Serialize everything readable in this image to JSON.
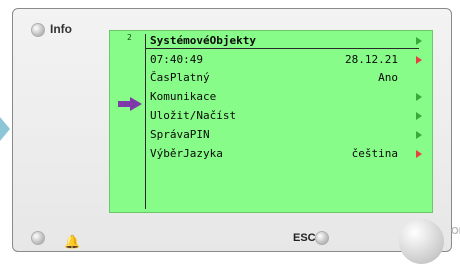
{
  "panel": {
    "info_label": "Info",
    "esc_label": "ESC",
    "ok_label": "OK"
  },
  "screen": {
    "page_number": "2",
    "rows": [
      {
        "label": "SystémovéObjekty",
        "value": "",
        "arrow": "green"
      },
      {
        "label": "07:40:49",
        "value": "28.12.21",
        "arrow": "red"
      },
      {
        "label": "ČasPlatný",
        "value": "Ano",
        "arrow": ""
      },
      {
        "label": "Komunikace",
        "value": "",
        "arrow": "green"
      },
      {
        "label": "Uložit/Načíst",
        "value": "",
        "arrow": "green"
      },
      {
        "label": "SprávaPIN",
        "value": "",
        "arrow": "green"
      },
      {
        "label": "VýběrJazyka",
        "value": "čeština",
        "arrow": "red"
      }
    ]
  },
  "colors": {
    "screen_bg": "#88fc88",
    "cursor_arrow": "#7e3aa8",
    "arrow_green": "#3aa83a",
    "arrow_red": "#e84040"
  },
  "icons": {
    "left_pointer": "triangle-right-icon",
    "bell": "bell-icon"
  }
}
